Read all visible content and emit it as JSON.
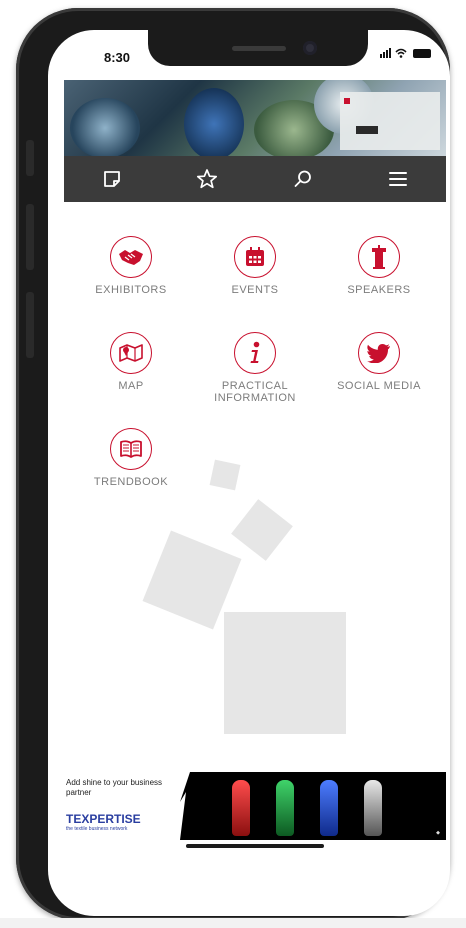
{
  "status": {
    "time": "8:30"
  },
  "banner": {
    "strip_items": [
      "",
      "",
      "",
      ""
    ],
    "card_text": ""
  },
  "navbar": {
    "items": [
      {
        "icon": "note-icon"
      },
      {
        "icon": "star-icon"
      },
      {
        "icon": "search-icon"
      },
      {
        "icon": "menu-icon"
      }
    ]
  },
  "tiles": [
    {
      "label": "EXHIBITORS",
      "icon": "handshake-icon"
    },
    {
      "label": "EVENTS",
      "icon": "calendar-icon"
    },
    {
      "label": "SPEAKERS",
      "icon": "podium-icon"
    },
    {
      "label": "MAP",
      "icon": "map-icon"
    },
    {
      "label": "PRACTICAL INFORMATION",
      "icon": "info-icon"
    },
    {
      "label": "SOCIAL MEDIA",
      "icon": "twitter-icon"
    },
    {
      "label": "TRENDBOOK",
      "icon": "book-icon"
    }
  ],
  "ad": {
    "tagline": "Add shine to your business partner",
    "brand": "TEXPERTISE",
    "brand_sub": "the textile business network"
  },
  "colors": {
    "accent": "#c8102e",
    "navbar": "#3b3b3b",
    "label": "#7c7c7c"
  }
}
